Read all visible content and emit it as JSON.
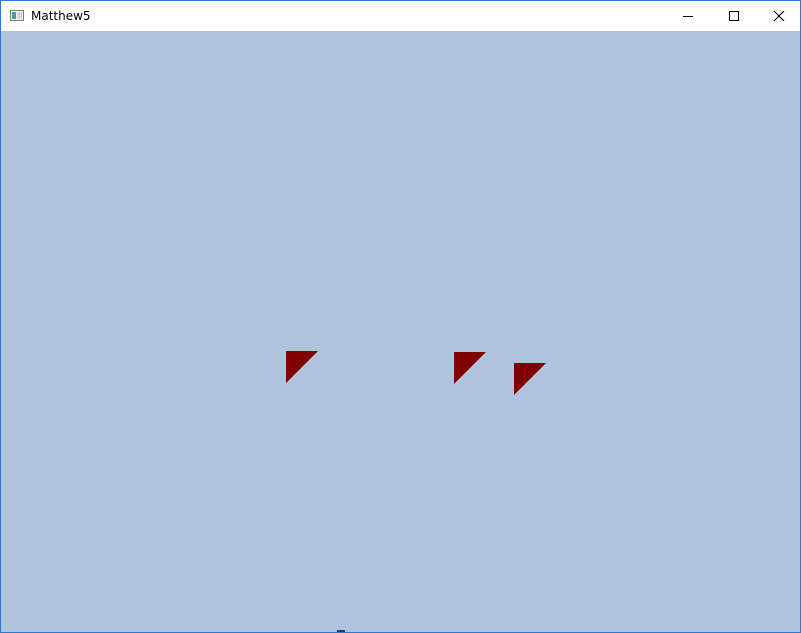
{
  "window": {
    "title": "Matthew5",
    "app_icon": "window-app-icon",
    "controls": {
      "minimize_icon": "minimize-icon",
      "maximize_icon": "maximize-icon",
      "close_icon": "close-icon"
    },
    "accent_color": "#2b78d0"
  },
  "canvas": {
    "background_color": "#b0c4de",
    "shape_color": "#800000",
    "shapes": [
      {
        "kind": "right-triangle"
      },
      {
        "kind": "right-triangle"
      },
      {
        "kind": "right-triangle"
      }
    ]
  }
}
